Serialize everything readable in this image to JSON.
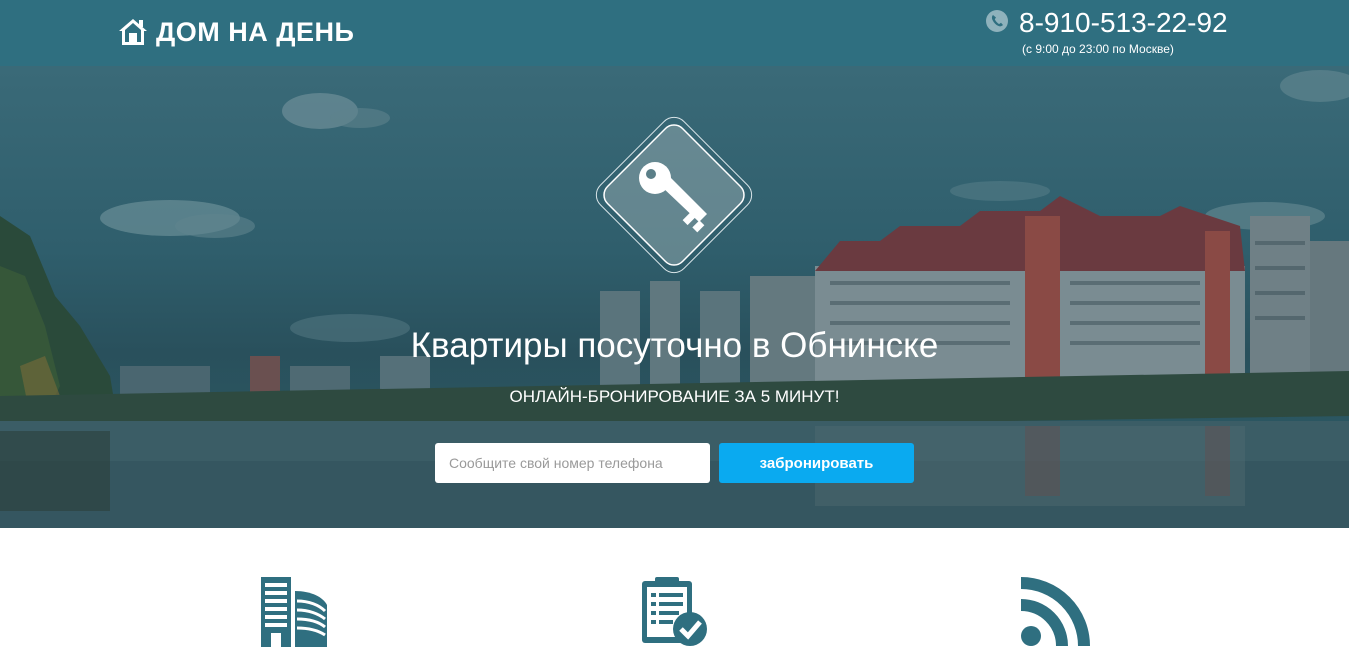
{
  "header": {
    "logo_text": "ДОМ НА ДЕНЬ",
    "logo_icon": "house-icon",
    "phone_icon": "phone-icon",
    "phone": "8-910-513-22-92",
    "hours": "(с 9:00 до 23:00 по Москве)"
  },
  "hero": {
    "badge_icon": "key-icon",
    "title": "Квартиры посуточно в Обнинске",
    "subtitle": "ОНЛАЙН-БРОНИРОВАНИЕ ЗА 5 МИНУТ!",
    "phone_input": {
      "placeholder": "Сообщите свой номер телефона",
      "value": ""
    },
    "book_button_label": "забронировать"
  },
  "features": {
    "icons": [
      "buildings-icon",
      "clipboard-check-icon",
      "rss-icon"
    ]
  },
  "colors": {
    "header_bg": "#2f6f80",
    "accent": "#0aaaf0",
    "feature_icon": "#2f6f80"
  }
}
